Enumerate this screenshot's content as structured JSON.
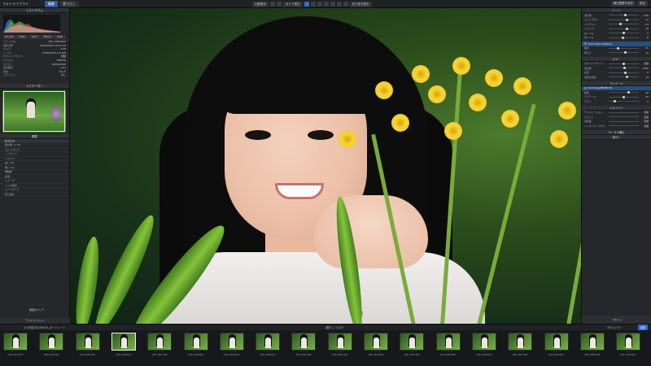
{
  "app": {
    "title": "フォトライブラリ",
    "tab_primary": "編集",
    "tab_secondary": "書き出し"
  },
  "toolbar": {
    "center_buttons": [
      "比較表示",
      "ガイド表示",
      "切り抜き表示"
    ],
    "right_buttons": [
      "補正履歴を保存",
      "設定"
    ]
  },
  "left_panel": {
    "histogram_title": "ヒストグラム",
    "chips": [
      "ISO 100",
      "1/250",
      "f/2.8",
      "85mm",
      "RAW"
    ],
    "info_rows": [
      {
        "label": "ファイル名",
        "value": "DSF_4556.RAF"
      },
      {
        "label": "撮影日時",
        "value": "2023/05/14 10:47:22"
      },
      {
        "label": "カメラ",
        "value": "X-T5"
      },
      {
        "label": "レンズ",
        "value": "XF56mmF1.2 R WR"
      },
      {
        "label": "ホワイトバランス",
        "value": "自動"
      },
      {
        "label": "フィルム",
        "value": "PROVIA"
      },
      {
        "label": "サイズ",
        "value": "6240x4160"
      },
      {
        "label": "露出補正",
        "value": "+0.3"
      },
      {
        "label": "測光",
        "value": "マルチ"
      },
      {
        "label": "フラッシュ",
        "value": "なし"
      }
    ],
    "navigator_title": "ナビゲーター",
    "navigator_zoom": "拡大表示",
    "history_title": "履歴",
    "history_items": [
      "読み込み",
      "露光量 +0.30",
      "コントラスト",
      "ハイライト",
      "シャドウ",
      "白レベル",
      "黒レベル",
      "明瞭度",
      "彩度",
      "シャープ",
      "ノイズ除去",
      "トーンカーブ",
      "切り抜き"
    ],
    "history_button": "履歴をクリア",
    "footer": "アジャストメント"
  },
  "right_panel": {
    "section_tone": "トーン",
    "tone_rows": [
      {
        "label": "露光量",
        "value": "0.30",
        "pos": 0.55
      },
      {
        "label": "コントラスト",
        "value": "12",
        "pos": 0.6
      },
      {
        "label": "ハイライト",
        "value": "-24",
        "pos": 0.38
      },
      {
        "label": "シャドウ",
        "value": "18",
        "pos": 0.62
      },
      {
        "label": "白レベル",
        "value": "0",
        "pos": 0.5
      },
      {
        "label": "黒レベル",
        "value": "-6",
        "pos": 0.47
      }
    ],
    "smart_lighting": "DxO Smart Lighting",
    "smart_rows": [
      {
        "label": "強度",
        "value": "25",
        "pos": 0.3
      },
      {
        "label": "明るさ",
        "value": "10",
        "pos": 0.55
      }
    ],
    "section_color": "カラー",
    "color_rows": [
      {
        "label": "ホワイトバランス",
        "value": "自動",
        "pos": 0.5
      },
      {
        "label": "色温度",
        "value": "5200",
        "pos": 0.52
      },
      {
        "label": "彩度",
        "value": "8",
        "pos": 0.56
      },
      {
        "label": "自然な彩度",
        "value": "14",
        "pos": 0.6
      }
    ],
    "section_detail": "ディテール",
    "detail_highlight": "DxO DeepPRIME XD",
    "detail_rows": [
      {
        "label": "輝度",
        "value": "40",
        "pos": 0.65
      },
      {
        "label": "ディテール",
        "value": "50",
        "pos": 0.5
      },
      {
        "label": "モアレ",
        "value": "0",
        "pos": 0.2
      }
    ],
    "section_geometry": "ジオメトリ",
    "geometry_rows": [
      {
        "label": "ディストーション",
        "value": "自動"
      },
      {
        "label": "ビネット",
        "value": "自動"
      },
      {
        "label": "色収差",
        "value": "自動"
      },
      {
        "label": "レンズシャープネス",
        "value": "自動"
      }
    ],
    "section_local": "ローカル補正",
    "section_watermark": "透かし",
    "footer": "リセット"
  },
  "filmbar": {
    "path": "D:\\写真\\2023\\0514_ポートレート",
    "count": "選択 1 / 1,025",
    "collection": "プロジェクト",
    "select_button": "比較"
  },
  "thumbnails": [
    {
      "name": "DSF_4553.RAF",
      "stars": "☆☆☆☆☆"
    },
    {
      "name": "DSF_4554.RAF",
      "stars": "☆☆☆☆☆"
    },
    {
      "name": "DSF_4555.RAF",
      "stars": "☆☆☆☆☆"
    },
    {
      "name": "DSF_4556.RAF",
      "stars": "☆☆☆☆☆"
    },
    {
      "name": "DSF_4557.RAF",
      "stars": "☆☆☆☆☆"
    },
    {
      "name": "DSF_4558.RAF",
      "stars": "☆☆☆☆☆"
    },
    {
      "name": "DSF_4559.RAF",
      "stars": "☆☆☆☆☆"
    },
    {
      "name": "DSF_4560.RAF",
      "stars": "☆☆☆☆☆"
    },
    {
      "name": "DSF_4561.RAF",
      "stars": "☆☆☆☆☆"
    },
    {
      "name": "DSF_4562.RAF",
      "stars": "☆☆☆☆☆"
    },
    {
      "name": "DSF_4563.RAF",
      "stars": "☆☆☆☆☆"
    },
    {
      "name": "DSF_4564.RAF",
      "stars": "☆☆☆☆☆"
    },
    {
      "name": "DSF_4565.RAF",
      "stars": "☆☆☆☆☆"
    },
    {
      "name": "DSF_4566.RAF",
      "stars": "☆☆☆☆☆"
    },
    {
      "name": "DSF_4567.RAF",
      "stars": "☆☆☆☆☆"
    },
    {
      "name": "DSF_4568.RAF",
      "stars": "☆☆☆☆☆"
    },
    {
      "name": "DSF_4569.RAF",
      "stars": "☆☆☆☆☆"
    },
    {
      "name": "DSF_4570.RAF",
      "stars": "☆☆☆☆☆"
    }
  ]
}
